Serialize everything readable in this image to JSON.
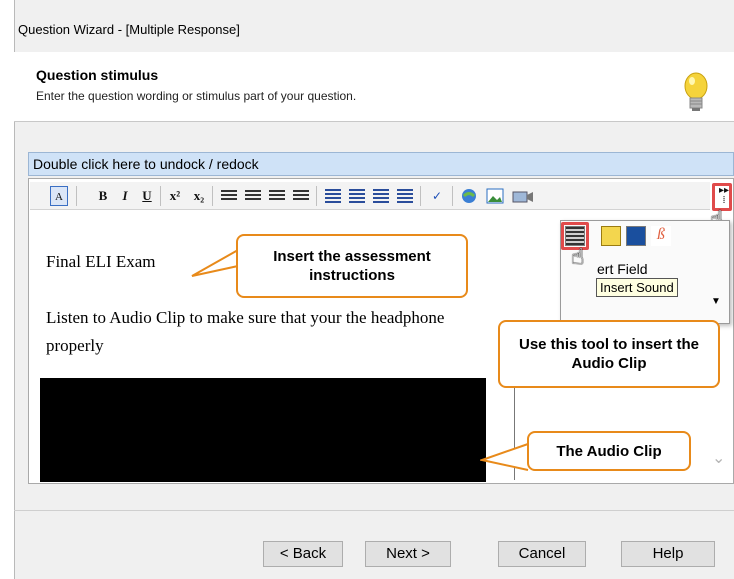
{
  "window": {
    "title": "Question Wizard - [Multiple Response]"
  },
  "header": {
    "title": "Question stimulus",
    "subtitle": "Enter the question wording or stimulus part of your question.",
    "icon": "lightbulb-icon"
  },
  "dock_bar": {
    "label": "Double click here to undock / redock"
  },
  "toolbar": {
    "items": [
      "style-icon",
      "bold-icon",
      "italic-icon",
      "underline-icon",
      "superscript-icon",
      "subscript-icon",
      "align-left-icon",
      "align-center-icon",
      "align-right-icon",
      "justify-icon",
      "numbered-list-icon",
      "bulleted-list-icon",
      "outdent-icon",
      "indent-icon",
      "spellcheck-icon",
      "link-icon",
      "image-icon",
      "media-icon",
      "more-tools-icon"
    ],
    "bold_label": "B",
    "italic_label": "I",
    "underline_label": "U",
    "superscript_label": "x²",
    "subscript_label": "x₂"
  },
  "content": {
    "line1": "Final ELI Exam",
    "line2": "Listen to Audio Clip to make sure that your the headphone",
    "line3": "properly"
  },
  "popup": {
    "partial_label": "ert Field",
    "tooltip": "Insert Sound"
  },
  "callouts": {
    "instructions": "Insert the assessment instructions",
    "tool": "Use this tool to insert the Audio Clip",
    "clip": "The Audio Clip"
  },
  "buttons": {
    "back": "< Back",
    "next": "Next >",
    "cancel": "Cancel",
    "help": "Help"
  },
  "colors": {
    "callout_border": "#e88a1a",
    "highlight_red": "#e04b4b",
    "dock_bar_bg": "#cfe2f7"
  }
}
